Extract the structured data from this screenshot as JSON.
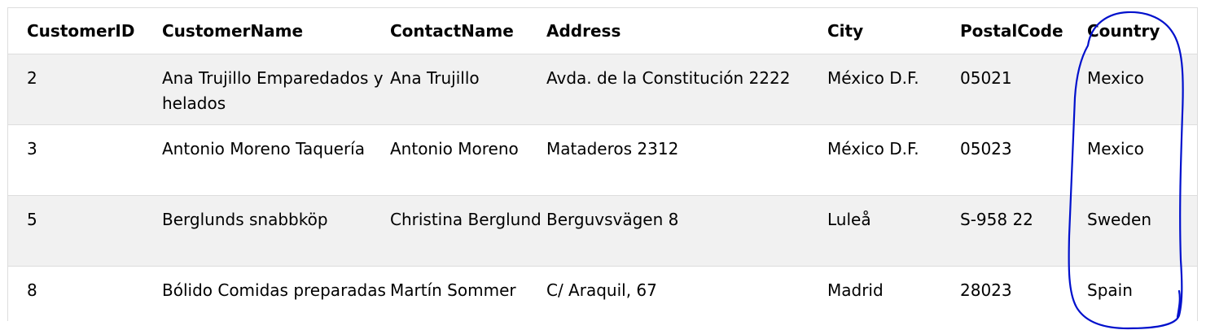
{
  "table": {
    "headers": [
      "CustomerID",
      "CustomerName",
      "ContactName",
      "Address",
      "City",
      "PostalCode",
      "Country"
    ],
    "rows": [
      [
        "2",
        "Ana Trujillo Emparedados y helados",
        "Ana Trujillo",
        "Avda. de la Constitución 2222",
        "México D.F.",
        "05021",
        "Mexico"
      ],
      [
        "3",
        "Antonio Moreno Taquería",
        "Antonio Moreno",
        "Mataderos 2312",
        "México D.F.",
        "05023",
        "Mexico"
      ],
      [
        "5",
        "Berglunds snabbköp",
        "Christina Berglund",
        "Berguvsvägen 8",
        "Luleå",
        "S-958 22",
        "Sweden"
      ],
      [
        "8",
        "Bólido Comidas preparadas",
        "Martín Sommer",
        "C/ Araquil, 67",
        "Madrid",
        "28023",
        "Spain"
      ]
    ]
  },
  "colors": {
    "header_border": "#dddddd",
    "row_shade": "#f1f1f1",
    "annotation_stroke": "#0010cc"
  }
}
